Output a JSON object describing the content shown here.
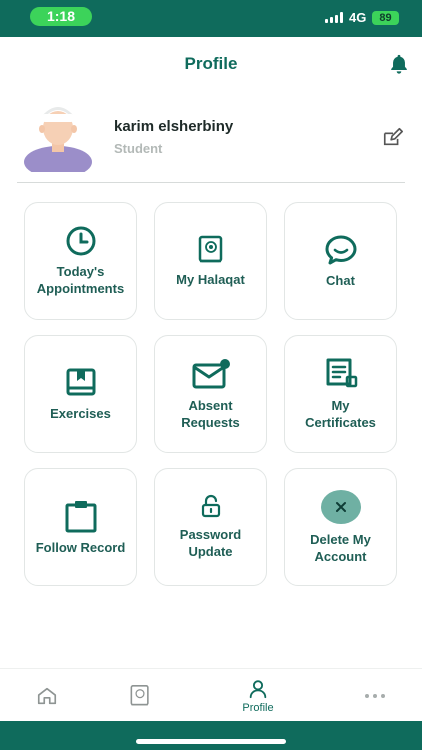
{
  "status_bar": {
    "time": "1:18",
    "network": "4G",
    "battery": "89"
  },
  "header": {
    "title": "Profile"
  },
  "profile": {
    "name": "karim elsherbiny",
    "role": "Student"
  },
  "tiles": [
    {
      "label": "Today's\nAppointments",
      "icon": "clock-icon"
    },
    {
      "label": "My Halaqat",
      "icon": "quran-book-icon"
    },
    {
      "label": "Chat",
      "icon": "chat-bubble-icon"
    },
    {
      "label": "Exercises",
      "icon": "bookmark-book-icon"
    },
    {
      "label": "Absent\nRequests",
      "icon": "mail-notification-icon"
    },
    {
      "label": "My\nCertificates",
      "icon": "certificate-icon"
    },
    {
      "label": "Follow Record",
      "icon": "clipboard-icon"
    },
    {
      "label": "Password\nUpdate",
      "icon": "unlock-icon"
    },
    {
      "label": "Delete My\nAccount",
      "icon": "close-circle-icon"
    }
  ],
  "bottom_nav": [
    {
      "label": "",
      "icon": "home-icon"
    },
    {
      "label": "",
      "icon": "quran-book-icon"
    },
    {
      "label": "Profile",
      "icon": "person-icon"
    },
    {
      "label": "",
      "icon": "more-dots-icon"
    }
  ],
  "colors": {
    "primary": "#0f6b5c",
    "status_green": "#3cd35a",
    "tile_label": "#1f5e55",
    "muted": "#b3b9b7"
  }
}
